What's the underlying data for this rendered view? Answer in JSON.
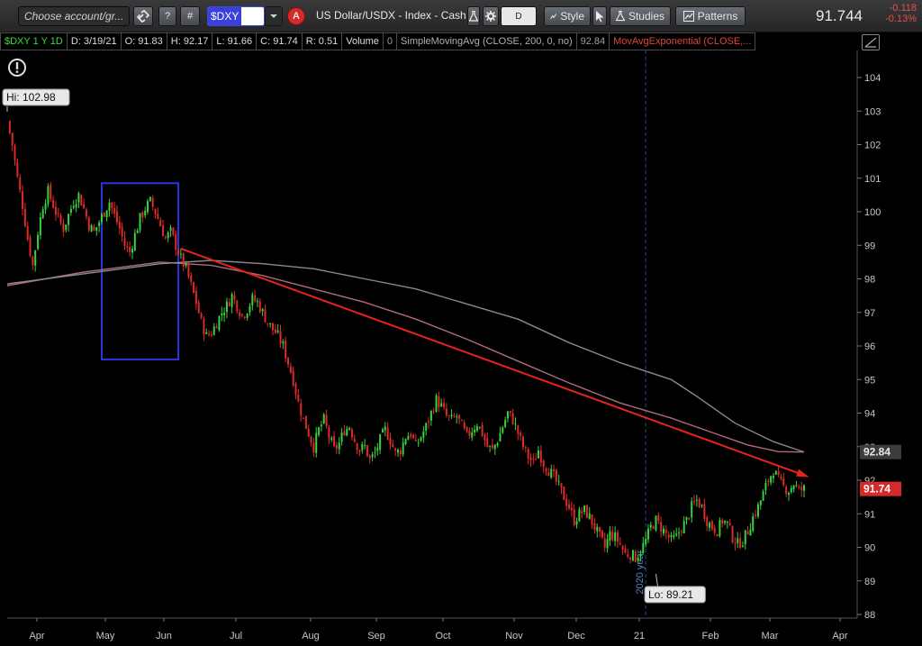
{
  "toolbar": {
    "account_placeholder": "Choose account/gr...",
    "help_label": "?",
    "hash_label": "#",
    "symbol": "$DXY",
    "alert_label": "A",
    "description": "US Dollar/USDX - Index - Cash",
    "aggregation": "D",
    "style_label": "Style",
    "studies_label": "Studies",
    "patterns_label": "Patterns",
    "last_price": "91.744",
    "net_change": "-0.118",
    "percent_change": "-0.13%"
  },
  "infobar": {
    "symbol_period": "$DXY 1 Y 1D",
    "date": "D: 3/19/21",
    "open": "O: 91.83",
    "high": "H: 92.17",
    "low": "L: 91.66",
    "close": "C: 91.74",
    "range": "R: 0.51",
    "volume_label": "Volume",
    "volume_value": "0",
    "sma_label": "SimpleMovingAvg (CLOSE, 200, 0, no)",
    "sma_value": "92.84",
    "ema_label": "MovAvgExponential (CLOSE,..."
  },
  "colors": {
    "up": "#36d43c",
    "down": "#e02a2a",
    "sma": "#8a8a8a",
    "ema": "#b06a78",
    "trendline": "#e8231f",
    "box": "#2a35e0",
    "background": "#000000"
  },
  "chart_data": {
    "type": "candlestick",
    "y_ticks": [
      "104",
      "103",
      "102",
      "101",
      "100",
      "99",
      "98",
      "97",
      "96",
      "95",
      "94",
      "93",
      "92",
      "91",
      "90",
      "89",
      "88"
    ],
    "x_ticks": [
      "Apr",
      "May",
      "Jun",
      "Jul",
      "Aug",
      "Sep",
      "Oct",
      "Nov",
      "Dec",
      "21",
      "Feb",
      "Mar",
      "Apr"
    ],
    "ylim": [
      88,
      104.5
    ],
    "hi_label": "Hi: 102.98",
    "lo_label": "Lo: 89.21",
    "year_marker_label": "2020 year",
    "sma_price_label": "92.84",
    "last_price_label": "91.74",
    "close_path": [
      [
        0,
        102.7
      ],
      [
        2,
        102.0
      ],
      [
        4,
        101.0
      ],
      [
        6,
        100.2
      ],
      [
        8,
        99.2
      ],
      [
        10,
        98.4
      ],
      [
        12,
        99.4
      ],
      [
        14,
        100.2
      ],
      [
        16,
        100.6
      ],
      [
        18,
        100.2
      ],
      [
        20,
        99.8
      ],
      [
        22,
        99.5
      ],
      [
        24,
        99.9
      ],
      [
        26,
        100.3
      ],
      [
        28,
        100.5
      ],
      [
        30,
        100.1
      ],
      [
        32,
        99.6
      ],
      [
        34,
        99.4
      ],
      [
        36,
        99.7
      ],
      [
        38,
        100.0
      ],
      [
        40,
        100.3
      ],
      [
        42,
        99.9
      ],
      [
        44,
        99.5
      ],
      [
        46,
        99.0
      ],
      [
        48,
        98.8
      ],
      [
        50,
        99.3
      ],
      [
        52,
        99.8
      ],
      [
        54,
        100.1
      ],
      [
        56,
        100.3
      ],
      [
        58,
        100.0
      ],
      [
        60,
        99.6
      ],
      [
        62,
        99.2
      ],
      [
        64,
        99.4
      ],
      [
        66,
        99.0
      ],
      [
        68,
        98.6
      ],
      [
        70,
        98.3
      ],
      [
        72,
        97.8
      ],
      [
        74,
        97.3
      ],
      [
        76,
        96.7
      ],
      [
        78,
        96.3
      ],
      [
        80,
        96.4
      ],
      [
        82,
        96.7
      ],
      [
        84,
        97.0
      ],
      [
        86,
        97.2
      ],
      [
        88,
        97.5
      ],
      [
        90,
        97.2
      ],
      [
        92,
        96.9
      ],
      [
        94,
        97.1
      ],
      [
        96,
        97.4
      ],
      [
        98,
        97.3
      ],
      [
        100,
        97.0
      ],
      [
        102,
        96.7
      ],
      [
        104,
        96.5
      ],
      [
        106,
        96.3
      ],
      [
        108,
        96.0
      ],
      [
        110,
        95.5
      ],
      [
        112,
        95.0
      ],
      [
        114,
        94.3
      ],
      [
        116,
        93.8
      ],
      [
        118,
        93.4
      ],
      [
        120,
        93.0
      ],
      [
        122,
        93.5
      ],
      [
        124,
        93.8
      ],
      [
        126,
        93.3
      ],
      [
        128,
        92.9
      ],
      [
        130,
        93.1
      ],
      [
        132,
        93.5
      ],
      [
        134,
        93.6
      ],
      [
        136,
        93.2
      ],
      [
        138,
        92.9
      ],
      [
        140,
        93.0
      ],
      [
        142,
        92.6
      ],
      [
        144,
        92.8
      ],
      [
        146,
        93.2
      ],
      [
        148,
        93.5
      ],
      [
        150,
        93.2
      ],
      [
        152,
        92.8
      ],
      [
        154,
        92.9
      ],
      [
        156,
        93.3
      ],
      [
        158,
        93.4
      ],
      [
        160,
        93.0
      ],
      [
        162,
        93.3
      ],
      [
        164,
        93.6
      ],
      [
        166,
        94.0
      ],
      [
        168,
        94.4
      ],
      [
        170,
        94.2
      ],
      [
        172,
        93.9
      ],
      [
        174,
        93.8
      ],
      [
        176,
        93.9
      ],
      [
        178,
        93.6
      ],
      [
        180,
        93.3
      ],
      [
        182,
        93.5
      ],
      [
        184,
        93.7
      ],
      [
        186,
        93.4
      ],
      [
        188,
        93.0
      ],
      [
        190,
        92.9
      ],
      [
        192,
        93.2
      ],
      [
        194,
        93.6
      ],
      [
        196,
        94.0
      ],
      [
        198,
        93.8
      ],
      [
        200,
        93.4
      ],
      [
        202,
        93.0
      ],
      [
        204,
        92.7
      ],
      [
        206,
        92.5
      ],
      [
        208,
        92.9
      ],
      [
        210,
        92.5
      ],
      [
        212,
        92.3
      ],
      [
        214,
        92.1
      ],
      [
        216,
        91.8
      ],
      [
        218,
        91.5
      ],
      [
        220,
        91.2
      ],
      [
        222,
        90.8
      ],
      [
        224,
        91.0
      ],
      [
        226,
        91.1
      ],
      [
        228,
        90.9
      ],
      [
        230,
        90.6
      ],
      [
        232,
        90.3
      ],
      [
        234,
        90.0
      ],
      [
        236,
        90.4
      ],
      [
        238,
        90.3
      ],
      [
        240,
        90.1
      ],
      [
        242,
        89.8
      ],
      [
        244,
        89.8
      ],
      [
        246,
        89.7
      ],
      [
        248,
        89.9
      ],
      [
        250,
        90.2
      ],
      [
        252,
        90.6
      ],
      [
        254,
        90.8
      ],
      [
        256,
        90.6
      ],
      [
        258,
        90.4
      ],
      [
        260,
        90.2
      ],
      [
        262,
        90.3
      ],
      [
        264,
        90.6
      ],
      [
        266,
        90.8
      ],
      [
        268,
        91.2
      ],
      [
        270,
        91.4
      ],
      [
        272,
        91.2
      ],
      [
        274,
        90.8
      ],
      [
        276,
        90.6
      ],
      [
        278,
        90.5
      ],
      [
        280,
        90.8
      ],
      [
        282,
        90.7
      ],
      [
        284,
        90.3
      ],
      [
        286,
        90.1
      ],
      [
        288,
        90.2
      ],
      [
        290,
        90.5
      ],
      [
        292,
        90.9
      ],
      [
        294,
        91.2
      ],
      [
        296,
        91.6
      ],
      [
        298,
        92.0
      ],
      [
        300,
        92.3
      ],
      [
        302,
        92.0
      ],
      [
        304,
        91.8
      ],
      [
        306,
        91.7
      ],
      [
        308,
        91.9
      ],
      [
        310,
        91.7
      ],
      [
        312,
        91.74
      ]
    ],
    "sma_path": [
      [
        0,
        97.85
      ],
      [
        30,
        98.15
      ],
      [
        60,
        98.45
      ],
      [
        80,
        98.55
      ],
      [
        100,
        98.45
      ],
      [
        120,
        98.3
      ],
      [
        140,
        98.0
      ],
      [
        160,
        97.7
      ],
      [
        180,
        97.25
      ],
      [
        200,
        96.8
      ],
      [
        220,
        96.1
      ],
      [
        240,
        95.5
      ],
      [
        260,
        95.0
      ],
      [
        270,
        94.5
      ],
      [
        285,
        93.7
      ],
      [
        300,
        93.15
      ],
      [
        312,
        92.84
      ]
    ],
    "ema_path": [
      [
        0,
        97.8
      ],
      [
        30,
        98.2
      ],
      [
        60,
        98.5
      ],
      [
        80,
        98.4
      ],
      [
        100,
        98.1
      ],
      [
        120,
        97.7
      ],
      [
        140,
        97.3
      ],
      [
        160,
        96.8
      ],
      [
        180,
        96.2
      ],
      [
        200,
        95.55
      ],
      [
        220,
        94.9
      ],
      [
        240,
        94.3
      ],
      [
        260,
        93.85
      ],
      [
        275,
        93.45
      ],
      [
        290,
        93.05
      ],
      [
        302,
        92.85
      ],
      [
        312,
        92.84
      ]
    ],
    "trendline": [
      [
        68,
        98.9
      ],
      [
        312,
        92.15
      ]
    ],
    "box": {
      "x0": 37,
      "x1": 67,
      "y0": 100.85,
      "y1": 95.6
    },
    "year_marker_x": 250
  }
}
